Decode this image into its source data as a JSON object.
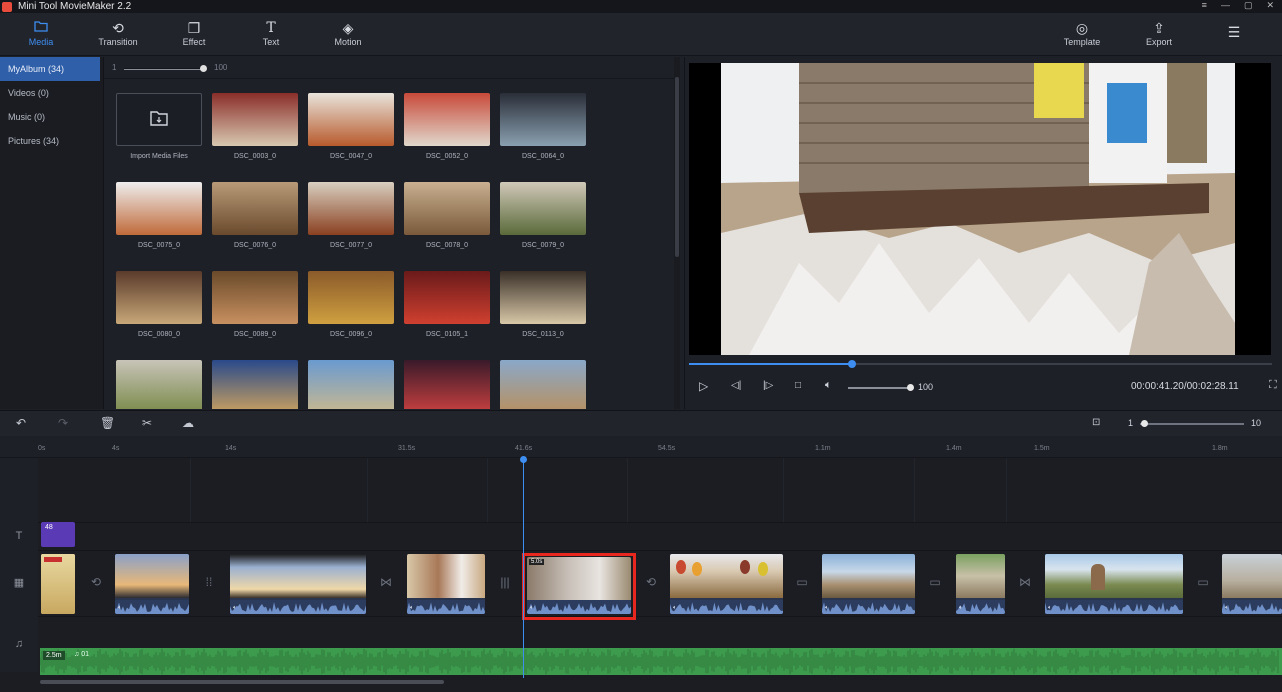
{
  "window": {
    "title": "Mini Tool MovieMaker 2.2"
  },
  "toolbar": {
    "tabs": [
      {
        "label": "Media",
        "icon": "folder-icon"
      },
      {
        "label": "Transition",
        "icon": "transition-icon"
      },
      {
        "label": "Effect",
        "icon": "effect-icon"
      },
      {
        "label": "Text",
        "icon": "text-icon"
      },
      {
        "label": "Motion",
        "icon": "motion-icon"
      }
    ],
    "template_label": "Template",
    "export_label": "Export"
  },
  "sidebar": {
    "items": [
      {
        "label": "MyAlbum (34)"
      },
      {
        "label": "Videos (0)"
      },
      {
        "label": "Music (0)"
      },
      {
        "label": "Pictures (34)"
      }
    ]
  },
  "media": {
    "zoom_min": "1",
    "zoom_max": "100",
    "import_label": "Import Media Files",
    "items": [
      {
        "caption": "DSC_0003_0",
        "colors": [
          "#8a2e2a",
          "#d8c8b0"
        ]
      },
      {
        "caption": "DSC_0047_0",
        "colors": [
          "#e8e4dc",
          "#b85a2c"
        ]
      },
      {
        "caption": "DSC_0052_0",
        "colors": [
          "#c84a3a",
          "#e0d8cc"
        ]
      },
      {
        "caption": "DSC_0064_0",
        "colors": [
          "#2a2e38",
          "#8aa0b0"
        ]
      },
      {
        "caption": "DSC_0075_0",
        "colors": [
          "#eeeeee",
          "#c06a3a"
        ]
      },
      {
        "caption": "DSC_0076_0",
        "colors": [
          "#b89a78",
          "#6a4a2c"
        ]
      },
      {
        "caption": "DSC_0077_0",
        "colors": [
          "#d8cfc0",
          "#8a4020"
        ]
      },
      {
        "caption": "DSC_0078_0",
        "colors": [
          "#c8b090",
          "#7a5a3a"
        ]
      },
      {
        "caption": "DSC_0079_0",
        "colors": [
          "#d0c8b8",
          "#5a6a3a"
        ]
      },
      {
        "caption": "DSC_0080_0",
        "colors": [
          "#5a3a2a",
          "#c8a878"
        ]
      },
      {
        "caption": "DSC_0089_0",
        "colors": [
          "#6a4a2a",
          "#c89060"
        ]
      },
      {
        "caption": "DSC_0096_0",
        "colors": [
          "#8a5a2a",
          "#d0a040"
        ]
      },
      {
        "caption": "DSC_0105_1",
        "colors": [
          "#6a1a1a",
          "#d04030"
        ]
      },
      {
        "caption": "DSC_0113_0",
        "colors": [
          "#3a3028",
          "#d8c8a8"
        ]
      },
      {
        "caption": "",
        "colors": [
          "#c8c4b8",
          "#7a8a4a"
        ]
      },
      {
        "caption": "",
        "colors": [
          "#2a4a8a",
          "#c8a060"
        ]
      },
      {
        "caption": "",
        "colors": [
          "#6a9ad0",
          "#c8b890"
        ]
      },
      {
        "caption": "",
        "colors": [
          "#3a1a2a",
          "#c84040"
        ]
      },
      {
        "caption": "",
        "colors": [
          "#8aa8c8",
          "#b89060"
        ]
      }
    ]
  },
  "preview": {
    "timecode": "00:00:41.20/00:02:28.11",
    "volume": "100",
    "progress": 0.28
  },
  "timeline": {
    "zoom_min": "1",
    "zoom_max": "10",
    "ruler": [
      "0s",
      "4s",
      "14s",
      "31.5s",
      "41.6s",
      "54.5s",
      "1.1m",
      "1.4m",
      "1.5m",
      "1.8m"
    ],
    "text_clip_label": "48",
    "music_duration": "2.5m",
    "music_label": "♫ 01",
    "selected_clip_duration": "5.0s"
  },
  "colors": {
    "accent": "#3d8ef0",
    "selection": "#e8271e",
    "audio": "#3c9b4d",
    "text_clip": "#5a3ab5"
  }
}
